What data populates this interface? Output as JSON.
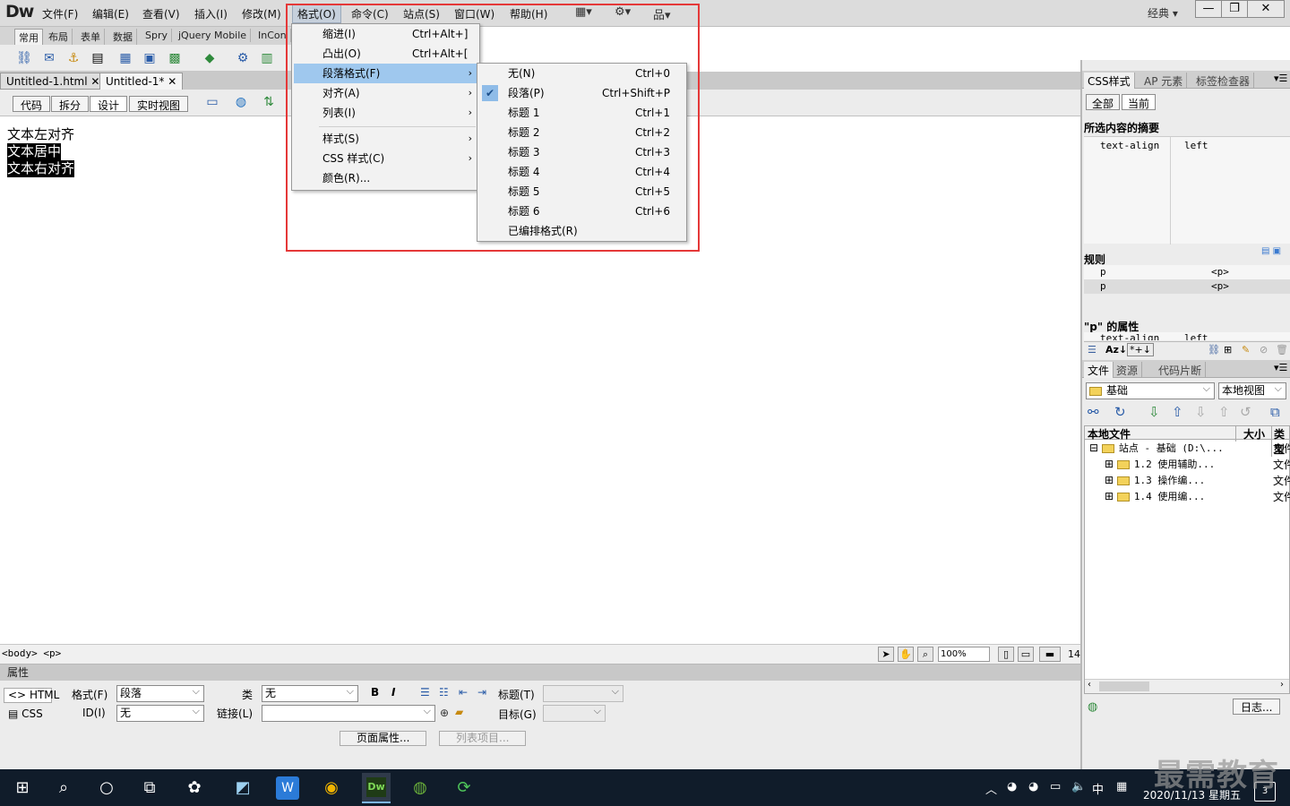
{
  "app": {
    "logo": "Dw",
    "mode": "经典"
  },
  "menubar": [
    "文件(F)",
    "编辑(E)",
    "查看(V)",
    "插入(I)",
    "修改(M)",
    "格式(O)",
    "命令(C)",
    "站点(S)",
    "窗口(W)",
    "帮助(H)"
  ],
  "insert_tabs": [
    "常用",
    "布局",
    "表单",
    "数据",
    "Spry",
    "jQuery Mobile",
    "InCon"
  ],
  "doc_tabs": [
    "Untitled-1.html",
    "Untitled-1*"
  ],
  "view_buttons": [
    "代码",
    "拆分",
    "设计",
    "实时视图"
  ],
  "design": {
    "line1": "文本左对齐",
    "line2": "文本居中",
    "line3": "文本右对齐"
  },
  "status": {
    "tags": "<body> <p>",
    "zoom": "100%",
    "num": "14"
  },
  "format_menu": [
    {
      "label": "缩进(I)",
      "key": "Ctrl+Alt+]"
    },
    {
      "label": "凸出(O)",
      "key": "Ctrl+Alt+["
    },
    {
      "label": "段落格式(F)"
    },
    {
      "label": "对齐(A)"
    },
    {
      "label": "列表(I)"
    },
    {
      "label": "样式(S)"
    },
    {
      "label": "CSS 样式(C)"
    },
    {
      "label": "颜色(R)..."
    }
  ],
  "para_menu": [
    {
      "label": "无(N)",
      "key": "Ctrl+0"
    },
    {
      "label": "段落(P)",
      "key": "Ctrl+Shift+P"
    },
    {
      "label": "标题 1",
      "key": "Ctrl+1"
    },
    {
      "label": "标题 2",
      "key": "Ctrl+2"
    },
    {
      "label": "标题 3",
      "key": "Ctrl+3"
    },
    {
      "label": "标题 4",
      "key": "Ctrl+4"
    },
    {
      "label": "标题 5",
      "key": "Ctrl+5"
    },
    {
      "label": "标题 6",
      "key": "Ctrl+6"
    },
    {
      "label": "已编排格式(R)"
    }
  ],
  "props": {
    "title": "属性",
    "html_btn": "HTML",
    "css_btn": "CSS",
    "format_label": "格式(F)",
    "format_value": "段落",
    "id_label": "ID(I)",
    "id_value": "无",
    "class_label": "类",
    "class_value": "无",
    "link_label": "链接(L)",
    "title_label": "标题(T)",
    "target_label": "目标(G)",
    "page_props": "页面属性...",
    "list_item": "列表项目..."
  },
  "css_panel": {
    "tabs": [
      "CSS样式",
      "AP 元素",
      "标签检查器"
    ],
    "subtabs": [
      "全部",
      "当前"
    ],
    "summary_title": "所选内容的摘要",
    "summary_prop": "text-align",
    "summary_val": "left",
    "rules_title": "规则",
    "rule1_sel": "p",
    "rule1_tag": "<p>",
    "rule2_sel": "p",
    "rule2_tag": "<p>",
    "props_title": "\"p\" 的属性",
    "props_prop": "text-align",
    "props_val": "left"
  },
  "files_panel": {
    "tabs": [
      "文件",
      "资源",
      "代码片断"
    ],
    "site": "基础",
    "view": "本地视图",
    "col_local": "本地文件",
    "col_size": "大小",
    "col_type": "类型",
    "tree": [
      {
        "label": "站点 - 基础 (D:\\...",
        "type": "文件"
      },
      {
        "label": "1.2 使用辅助...",
        "type": "文件"
      },
      {
        "label": "1.3 操作编...",
        "type": "文件"
      },
      {
        "label": "1.4 使用编...",
        "type": "文件"
      }
    ],
    "log": "日志..."
  },
  "taskbar": {
    "ime": "中",
    "clock": "2020/11/13 星期五",
    "notif": "3"
  },
  "watermark": "最需教育",
  "colors": {
    "highlight": "#9fc8ee",
    "redbox": "#e53838",
    "taskbar": "#101c2a"
  }
}
